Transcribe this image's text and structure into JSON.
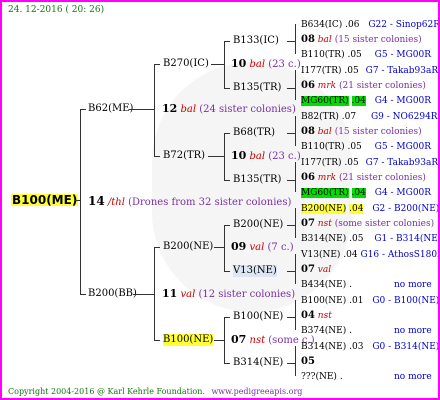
{
  "header": {
    "date": "24. 12-2016 ( 20: 26)"
  },
  "footer": {
    "copyright": "Copyright 2004-2016 @ Karl Kehrle Foundation.",
    "url": "www.pedigreeapis.org"
  },
  "root": {
    "name": "B100(ME)",
    "gen": "14",
    "tag": "/thl",
    "note": "(Drones from 32 sister colonies)"
  },
  "g1": [
    {
      "name": "B62(ME)",
      "gen": "12",
      "tag": "bal",
      "note": "(24 sister colonies)"
    },
    {
      "name": "B200(BB)",
      "gen": "11",
      "tag": "val",
      "note": "(12 sister colonies)"
    }
  ],
  "g2": [
    {
      "name": "B270(IC)",
      "gen": "10",
      "tag": "bal",
      "note": "(23 c.)"
    },
    {
      "name": "B72(TR)",
      "gen": "10",
      "tag": "bal",
      "note": "(23 c.)"
    },
    {
      "name": "B200(NE)",
      "gen": "09",
      "tag": "val",
      "note": "(7 c.)"
    },
    {
      "name": "B100(NE)",
      "gen": "07",
      "tag": "nst",
      "note": "(some c.)"
    }
  ],
  "g3": [
    {
      "name": "B133(IC)"
    },
    {
      "name": "B135(TR)"
    },
    {
      "name": "B68(TR)"
    },
    {
      "name": "B135(TR)"
    },
    {
      "name": "B200(NE)"
    },
    {
      "name": "V13(NE)"
    },
    {
      "name": "B100(NE)"
    },
    {
      "name": "B314(NE)"
    }
  ],
  "g4": [
    {
      "sire": "B634(IC)",
      "sire_gen": ".06",
      "sire_link": "G22 - Sinop62R",
      "gen": "08",
      "tag": "bal",
      "note": "(15 sister colonies)",
      "dam": "B110(TR)",
      "dam_gen": ".05",
      "dam_link": "G5 - MG00R"
    },
    {
      "sire": "I177(TR)",
      "sire_gen": ".05",
      "sire_link": "G7 - Takab93aR",
      "gen": "06",
      "tag": "mrk",
      "note": "(21 sister colonies)",
      "dam": "MG60(TR)",
      "dam_gen": ".04",
      "dam_link": "G4 - MG00R"
    },
    {
      "sire": "B82(TR)",
      "sire_gen": ".07",
      "sire_link": "G9 - NO6294R",
      "gen": "08",
      "tag": "bal",
      "note": "(15 sister colonies)",
      "dam": "B110(TR)",
      "dam_gen": ".05",
      "dam_link": "G5 - MG00R"
    },
    {
      "sire": "I177(TR)",
      "sire_gen": ".05",
      "sire_link": "G7 - Takab93aR",
      "gen": "06",
      "tag": "mrk",
      "note": "(21 sister colonies)",
      "dam": "MG60(TR)",
      "dam_gen": ".04",
      "dam_link": "G4 - MG00R"
    },
    {
      "sire": "B200(NE)",
      "sire_gen": ".04",
      "sire_link": "G2 - B200(NE)",
      "gen": "07",
      "tag": "nst",
      "note": "(some sister colonies)",
      "dam": "B314(NE)",
      "dam_gen": ".05",
      "dam_link": "G1 - B314(NE)"
    },
    {
      "sire": "V13(NE)",
      "sire_gen": ".04",
      "sire_link": "G16 - AthosS180R",
      "gen": "07",
      "tag": "val",
      "note": "",
      "dam": "B434(NE)",
      "dam_gen": ".",
      "dam_link": "no more"
    },
    {
      "sire": "B100(NE)",
      "sire_gen": ".01",
      "sire_link": "G0 - B100(NE)",
      "gen": "04",
      "tag": "nst",
      "note": "",
      "dam": "B374(NE)",
      "dam_gen": ".",
      "dam_link": "no more"
    },
    {
      "sire": "B314(NE)",
      "sire_gen": ".03",
      "sire_link": "G0 - B314(NE)",
      "gen": "05",
      "tag": "",
      "note": "",
      "dam": "???(NE)",
      "dam_gen": ".",
      "dam_link": "no more"
    }
  ]
}
